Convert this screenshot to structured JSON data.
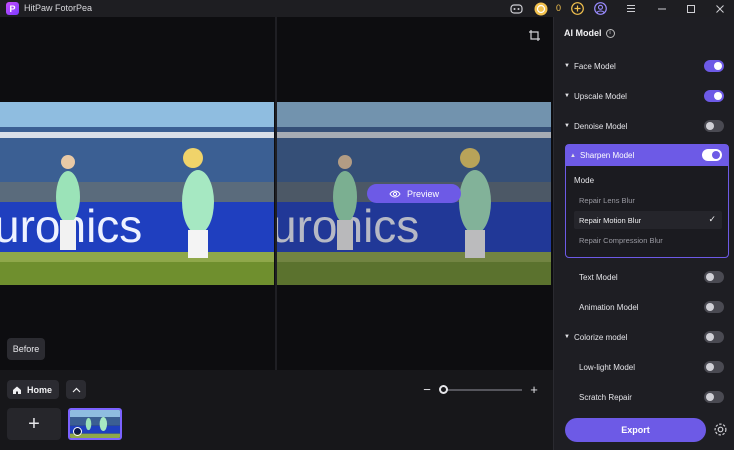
{
  "app": {
    "logo_letter": "P",
    "title": "HitPaw FotorPea",
    "coins": "0"
  },
  "titlebar_icons": [
    "discord-icon",
    "coin-icon",
    "add-coin-icon",
    "account-icon",
    "menu-icon",
    "minimize-icon",
    "maximize-icon",
    "close-icon"
  ],
  "editor": {
    "preview_label": "Preview",
    "before_label": "Before",
    "banner_text": "uronics"
  },
  "bottom": {
    "home_label": "Home",
    "zoom_minus": "−",
    "zoom_plus": "+",
    "add_label": "+",
    "zoom_level": 0
  },
  "panel": {
    "title": "AI Model",
    "info": "i",
    "models_top": [
      {
        "label": "Face Model",
        "caret": true,
        "on": true
      },
      {
        "label": "Upscale Model",
        "caret": true,
        "on": true
      },
      {
        "label": "Denoise Model",
        "caret": true,
        "on": false
      }
    ],
    "sharpen": {
      "label": "Sharpen Model",
      "on": true,
      "mode_label": "Mode",
      "options": [
        {
          "label": "Repair Lens Blur",
          "selected": false
        },
        {
          "label": "Repair Motion Blur",
          "selected": true
        },
        {
          "label": "Repair Compression Blur",
          "selected": false
        }
      ],
      "check": "✓"
    },
    "models_bottom": [
      {
        "label": "Text Model",
        "caret": false,
        "on": false
      },
      {
        "label": "Animation Model",
        "caret": false,
        "on": false
      },
      {
        "label": "Colorize model",
        "caret": true,
        "on": false
      },
      {
        "label": "Low-light Model",
        "caret": false,
        "on": false
      },
      {
        "label": "Scratch Repair",
        "caret": false,
        "on": false
      }
    ],
    "export_label": "Export"
  },
  "colors": {
    "accent": "#6d5ae6",
    "background": "#1c1c20",
    "coin": "#f2c14e"
  }
}
